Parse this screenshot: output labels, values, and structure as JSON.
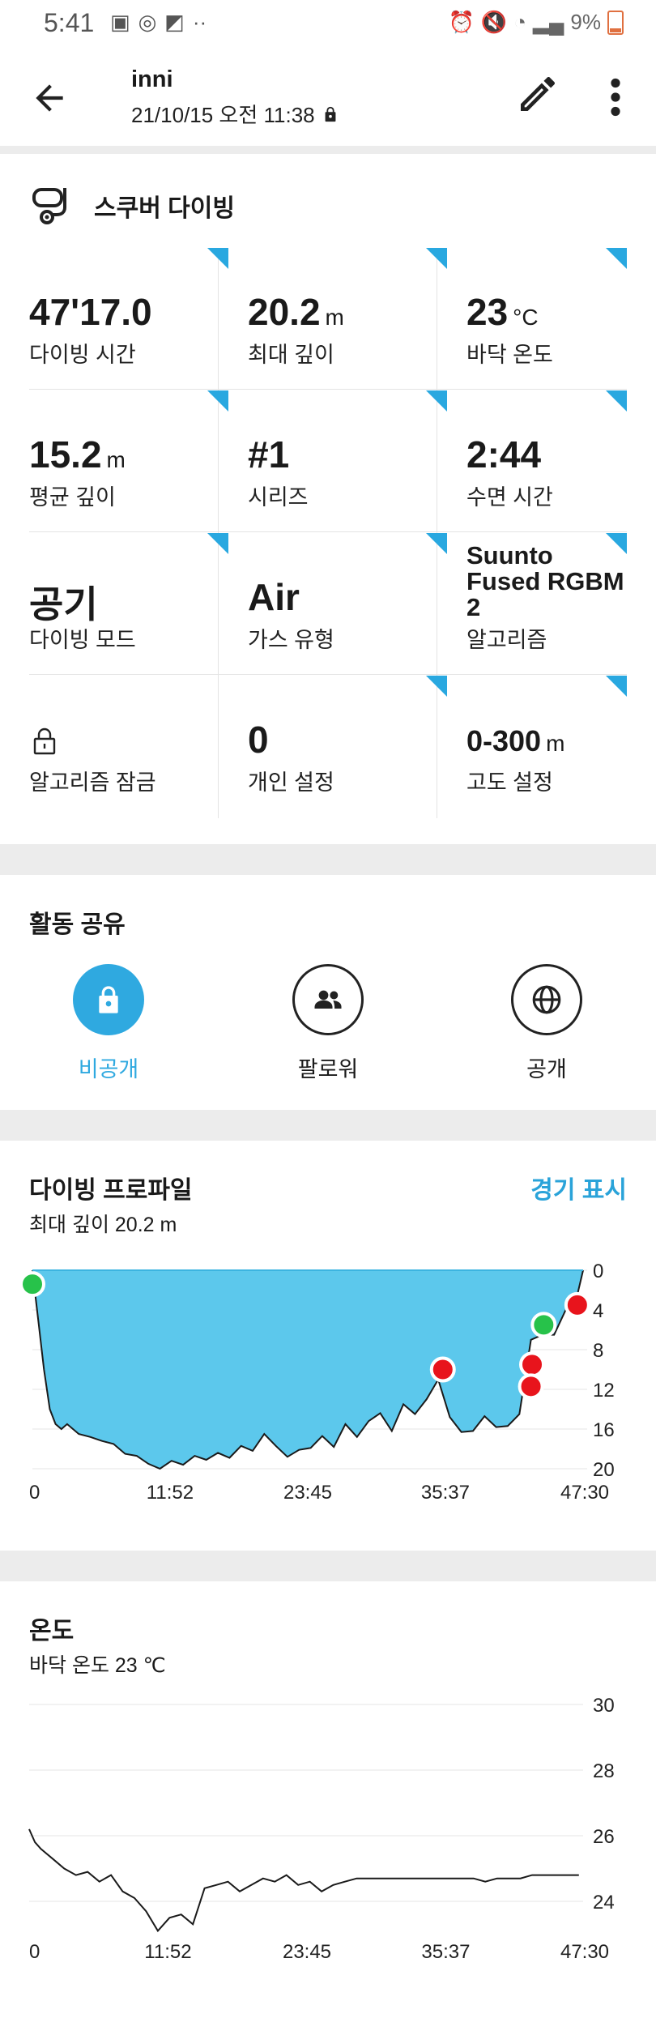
{
  "status_bar": {
    "time": "5:41",
    "battery": "9%"
  },
  "header": {
    "title": "inni",
    "subtitle": "21/10/15 오전 11:38"
  },
  "sport": {
    "name": "스쿠버 다이빙"
  },
  "stats": [
    {
      "value": "47'17.0",
      "unit": "",
      "label": "다이빙 시간"
    },
    {
      "value": "20.2",
      "unit": "m",
      "label": "최대 깊이"
    },
    {
      "value": "23",
      "unit": "°C",
      "label": "바닥 온도"
    },
    {
      "value": "15.2",
      "unit": "m",
      "label": "평균 깊이"
    },
    {
      "value": "#1",
      "unit": "",
      "label": "시리즈"
    },
    {
      "value": "2:44",
      "unit": "",
      "label": "수면 시간"
    },
    {
      "value": "공기",
      "unit": "",
      "label": "다이빙 모드"
    },
    {
      "value": "Air",
      "unit": "",
      "label": "가스 유형"
    },
    {
      "value": "Suunto Fused RGBM 2",
      "unit": "",
      "label": "알고리즘"
    },
    {
      "value": "",
      "unit": "",
      "label": "알고리즘 잠금"
    },
    {
      "value": "0",
      "unit": "",
      "label": "개인 설정"
    },
    {
      "value": "0-300",
      "unit": "m",
      "label": "고도 설정"
    }
  ],
  "share": {
    "title": "활동 공유",
    "options": [
      {
        "label": "비공개",
        "selected": true
      },
      {
        "label": "팔로워",
        "selected": false
      },
      {
        "label": "공개",
        "selected": false
      }
    ],
    "accent": "#2fa9e0"
  },
  "profile": {
    "title": "다이빙 프로파일",
    "subtitle": "최대 깊이 20.2 m",
    "link": "경기 표시"
  },
  "temperature": {
    "title": "온도",
    "subtitle": "바닥 온도 23 ℃"
  },
  "chart_data": [
    {
      "type": "area",
      "title": "다이빙 프로파일",
      "x_ticks": [
        "0",
        "11:52",
        "23:45",
        "35:37",
        "47:30"
      ],
      "y_ticks": [
        "0",
        "4",
        "8",
        "12",
        "16",
        "20"
      ],
      "ylim": [
        0,
        20
      ],
      "y_inverted": true,
      "x_minutes": [
        0,
        0.5,
        1,
        1.5,
        2,
        2.5,
        3,
        4,
        5,
        6,
        7,
        8,
        9,
        10,
        11,
        12,
        13,
        14,
        15,
        16,
        17,
        18,
        19,
        20,
        21,
        22,
        23,
        24,
        25,
        26,
        27,
        28,
        29,
        30,
        31,
        32,
        33,
        34,
        35,
        36,
        37,
        38,
        39,
        40,
        41,
        42,
        43,
        44,
        45,
        46,
        47,
        47.5
      ],
      "depth_m": [
        0,
        5,
        10,
        14,
        15.5,
        16,
        15.5,
        16.5,
        16.8,
        17.2,
        17.5,
        18.5,
        18.7,
        19.5,
        20,
        19.2,
        19.6,
        18.7,
        19.1,
        18.4,
        18.9,
        17.7,
        18.2,
        16.5,
        17.7,
        18.8,
        18.1,
        17.9,
        16.7,
        17.8,
        15.5,
        16.8,
        15.2,
        14.4,
        16.2,
        13.5,
        14.5,
        13,
        11,
        14.8,
        16.3,
        16.2,
        14.7,
        15.8,
        15.7,
        14.5,
        7,
        6.5,
        6.5,
        4,
        2.5,
        0
      ],
      "markers": [
        {
          "minute": 0,
          "depth_m": 1.4,
          "color": "#27c24a"
        },
        {
          "minute": 35.4,
          "depth_m": 10,
          "color": "#e8141c"
        },
        {
          "minute": 43.1,
          "depth_m": 9.5,
          "color": "#e8141c"
        },
        {
          "minute": 43,
          "depth_m": 11.7,
          "color": "#e8141c"
        },
        {
          "minute": 44.1,
          "depth_m": 5.5,
          "color": "#27c24a"
        },
        {
          "minute": 47,
          "depth_m": 3.5,
          "color": "#e8141c"
        }
      ],
      "fill_color": "#5cc8ec"
    },
    {
      "type": "line",
      "title": "온도",
      "x_ticks": [
        "0",
        "11:52",
        "23:45",
        "35:37",
        "47:30"
      ],
      "y_ticks": [
        "30",
        "28",
        "26",
        "24"
      ],
      "ylim": [
        22.6,
        30
      ],
      "x_minutes": [
        0,
        0.5,
        1,
        2,
        3,
        4,
        5,
        6,
        7,
        8,
        9,
        10,
        11,
        12,
        13,
        14,
        15,
        16,
        17,
        18,
        19,
        20,
        21,
        22,
        23,
        24,
        25,
        26,
        27,
        28,
        29,
        30,
        31,
        32,
        33,
        34,
        35,
        36,
        37,
        38,
        39,
        40,
        41,
        42,
        43,
        44,
        45,
        46,
        47
      ],
      "temp_c": [
        26.2,
        25.8,
        25.6,
        25.3,
        25,
        24.8,
        24.9,
        24.6,
        24.8,
        24.3,
        24.1,
        23.7,
        23.1,
        23.5,
        23.6,
        23.3,
        24.4,
        24.5,
        24.6,
        24.3,
        24.5,
        24.7,
        24.6,
        24.8,
        24.5,
        24.6,
        24.3,
        24.5,
        24.6,
        24.7,
        24.7,
        24.7,
        24.7,
        24.7,
        24.7,
        24.7,
        24.7,
        24.7,
        24.7,
        24.7,
        24.6,
        24.7,
        24.7,
        24.7,
        24.8,
        24.8,
        24.8,
        24.8,
        24.8
      ]
    }
  ]
}
